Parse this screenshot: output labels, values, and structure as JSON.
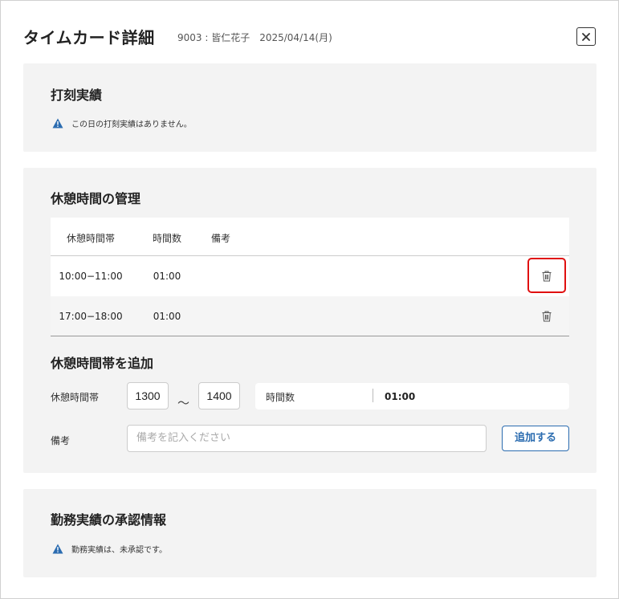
{
  "header": {
    "title": "タイムカード詳細",
    "employee": "9003 : 皆仁花子",
    "date": "2025/04/14(月)",
    "close_icon": "close-icon"
  },
  "clock_records": {
    "title": "打刻実績",
    "notice": "この日の打刻実績はありません。",
    "notice_icon": "warning-icon"
  },
  "break_management": {
    "title": "休憩時間の管理",
    "columns": [
      "休憩時間帯",
      "時間数",
      "備考"
    ],
    "rows": [
      {
        "range": "10:00−11:00",
        "duration": "01:00",
        "note": ""
      },
      {
        "range": "17:00−18:00",
        "duration": "01:00",
        "note": ""
      }
    ],
    "delete_icon": "trash-icon",
    "highlight_color": "#e01010"
  },
  "add_break": {
    "title": "休憩時間帯を追加",
    "range_label": "休憩時間帯",
    "start_value": "1300",
    "separator": "〜",
    "end_value": "1400",
    "duration_label": "時間数",
    "duration_value": "01:00",
    "note_label": "備考",
    "note_placeholder": "備考を記入ください",
    "submit_label": "追加する",
    "accent_color": "#2b6cb0"
  },
  "approval": {
    "title": "勤務実績の承認情報",
    "notice": "勤務実績は、未承認です。",
    "notice_icon": "warning-icon"
  }
}
